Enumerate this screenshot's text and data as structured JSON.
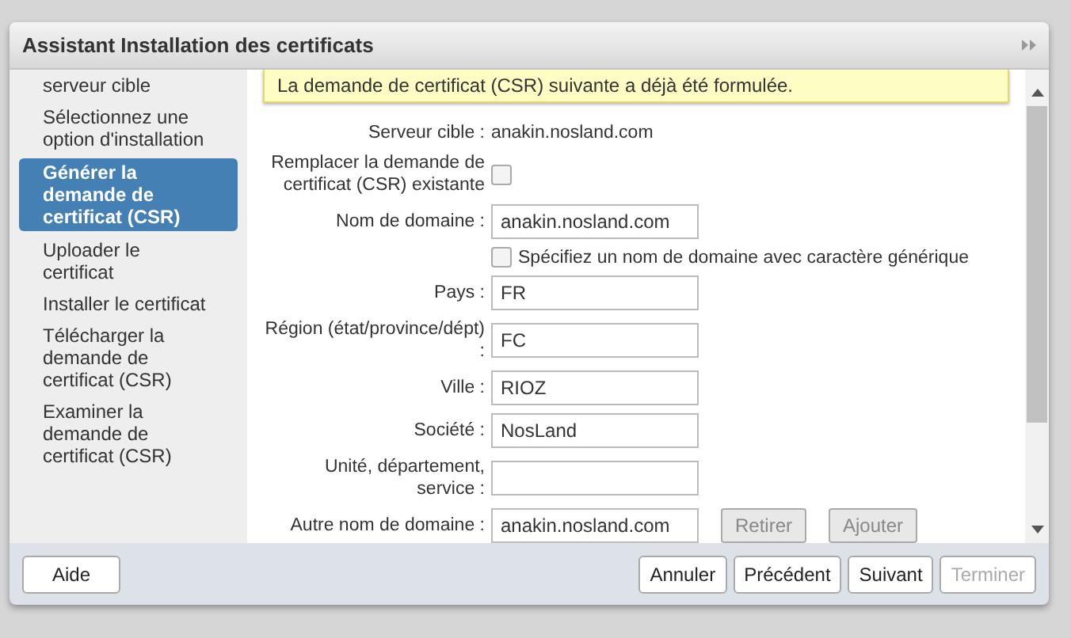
{
  "window": {
    "title": "Assistant Installation des certificats"
  },
  "sidebar": {
    "items": [
      {
        "label": "serveur cible",
        "selected": false
      },
      {
        "label": "Sélectionnez une option d'installation",
        "selected": false
      },
      {
        "label": "Générer la demande de certificat (CSR)",
        "selected": true
      },
      {
        "label": "Uploader le certificat",
        "selected": false
      },
      {
        "label": "Installer le certificat",
        "selected": false
      },
      {
        "label": "Télécharger la demande de certificat (CSR)",
        "selected": false
      },
      {
        "label": "Examiner la demande de certificat (CSR)",
        "selected": false
      }
    ]
  },
  "banner": {
    "text": "La demande de certificat (CSR) suivante a déjà été formulée."
  },
  "form": {
    "rows": [
      {
        "kind": "text",
        "label": "Serveur cible :",
        "value": "anakin.nosland.com"
      },
      {
        "kind": "checkbox",
        "label": "Remplacer la demande de certificat (CSR) existante",
        "checked": false
      },
      {
        "kind": "input",
        "label": "Nom de domaine :",
        "value": "anakin.nosland.com"
      },
      {
        "kind": "option",
        "text": "Spécifiez un nom de domaine avec caractère générique",
        "checked": false
      },
      {
        "kind": "input",
        "label": "Pays :",
        "value": "FR"
      },
      {
        "kind": "input",
        "label": "Région (état/province/dépt) :",
        "value": "FC"
      },
      {
        "kind": "input",
        "label": "Ville :",
        "value": "RIOZ"
      },
      {
        "kind": "input",
        "label": "Société :",
        "value": "NosLand"
      },
      {
        "kind": "input",
        "label": "Unité, département, service :",
        "value": ""
      },
      {
        "kind": "input",
        "label": "Autre nom de domaine :",
        "value": "anakin.nosland.com",
        "buttons": [
          {
            "label": "Retirer",
            "disabled": true
          },
          {
            "label": "Ajouter",
            "disabled": true
          }
        ]
      }
    ]
  },
  "footer": {
    "left": [
      {
        "label": "Aide",
        "disabled": false
      }
    ],
    "right": [
      {
        "label": "Annuler",
        "disabled": false
      },
      {
        "label": "Précédent",
        "disabled": false
      },
      {
        "label": "Suivant",
        "disabled": false
      },
      {
        "label": "Terminer",
        "disabled": true
      }
    ]
  }
}
